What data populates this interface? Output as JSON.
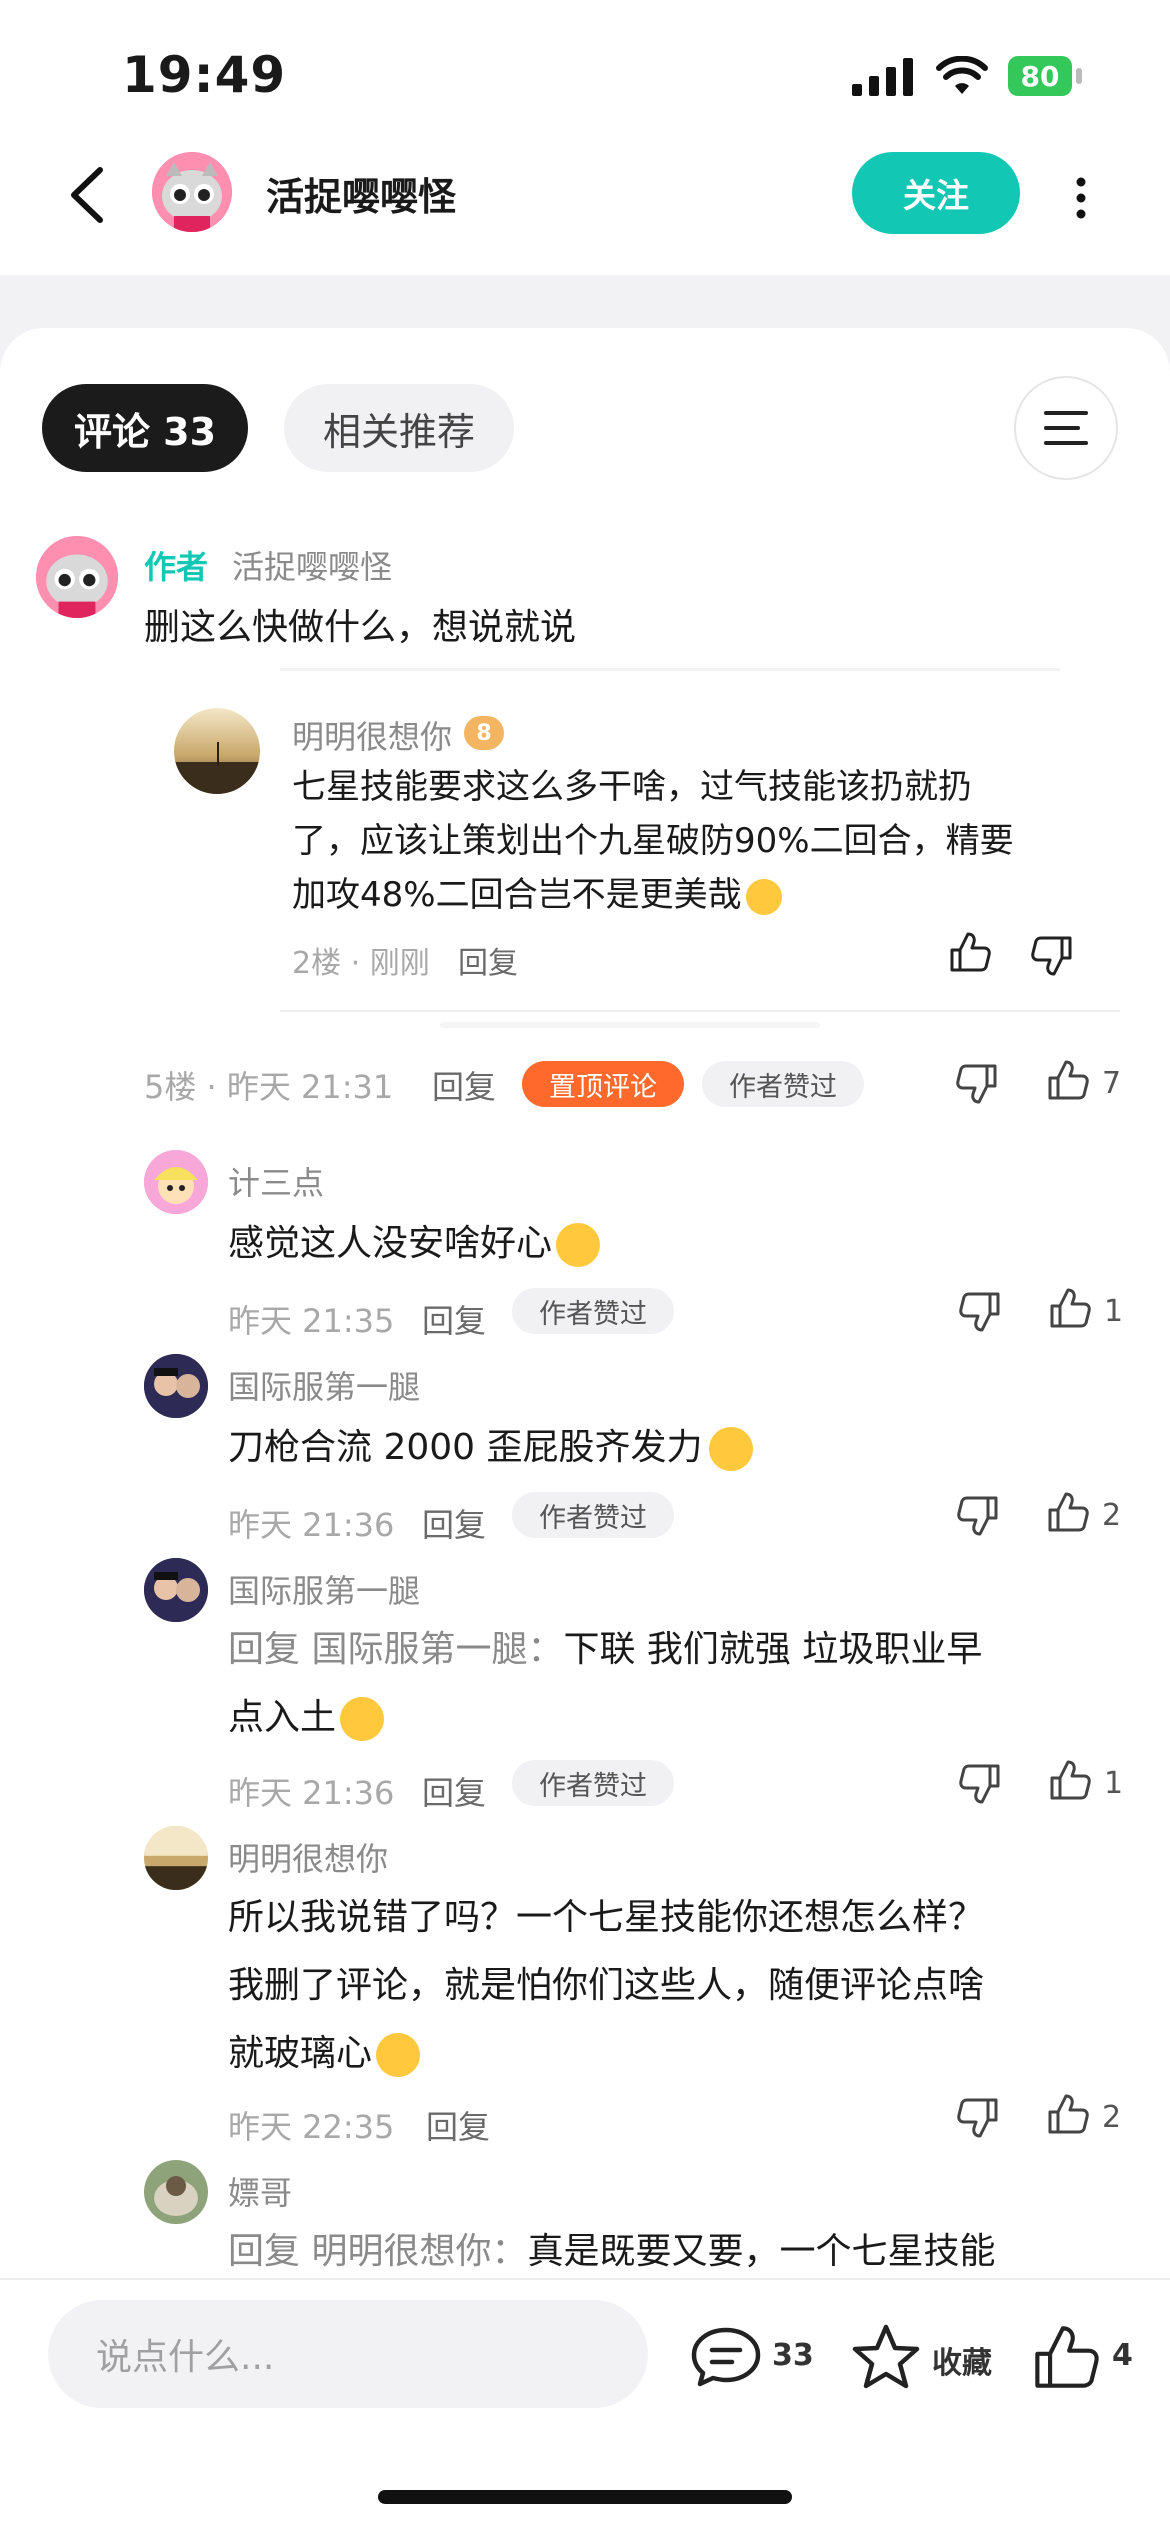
{
  "status": {
    "time": "19:49",
    "battery": "80"
  },
  "header": {
    "title": "活捉嘤嘤怪",
    "follow_label": "关注"
  },
  "tabs": {
    "comments": "评论 33",
    "related": "相关推荐"
  },
  "author_comment": {
    "badge": "作者",
    "name": "活捉嘤嘤怪",
    "text": "删这么快做什么，想说就说"
  },
  "quoted": {
    "name": "明明很想你",
    "level": "8",
    "text_lines": [
      "七星技能要求这么多干啥，过气技能该扔就扔",
      "了，应该让策划出个九星破防90%二回合，精要",
      "加攻48%二回合岂不是更美哉"
    ],
    "meta": "2楼 · 刚刚",
    "reply": "回复"
  },
  "main_meta": {
    "meta": "5楼 · 昨天 21:31",
    "reply": "回复",
    "pinned": "置顶评论",
    "liked_by_author": "作者赞过",
    "likes": "7"
  },
  "replies": [
    {
      "name": "计三点",
      "lines": [
        "感觉这人没安啥好心"
      ],
      "prefix": "",
      "time": "昨天 21:35",
      "reply": "回复",
      "chip": "作者赞过",
      "likes": "1"
    },
    {
      "name": "国际服第一腿",
      "lines": [
        "刀枪合流 2000 歪屁股齐发力"
      ],
      "prefix": "",
      "time": "昨天 21:36",
      "reply": "回复",
      "chip": "作者赞过",
      "likes": "2"
    },
    {
      "name": "国际服第一腿",
      "prefix": "回复 国际服第一腿：",
      "lines": [
        "下联 我们就强 垃圾职业早",
        "点入土"
      ],
      "time": "昨天 21:36",
      "reply": "回复",
      "chip": "作者赞过",
      "likes": "1"
    },
    {
      "name": "明明很想你",
      "lines": [
        "所以我说错了吗？一个七星技能你还想怎么样？",
        "我删了评论，就是怕你们这些人，随便评论点啥",
        "就玻璃心"
      ],
      "prefix": "",
      "time": "昨天 22:35",
      "reply": "回复",
      "chip": "",
      "likes": "2"
    },
    {
      "name": "嫖哥",
      "prefix": "回复 明明很想你：",
      "lines": [
        "真是既要又要，一个七星技能"
      ]
    }
  ],
  "bottom": {
    "placeholder": "说点什么...",
    "comment_count": "33",
    "favorite": "收藏",
    "likes": "4"
  },
  "colors": {
    "accent": "#13c7b5",
    "pinned": "#ff6a2c"
  }
}
